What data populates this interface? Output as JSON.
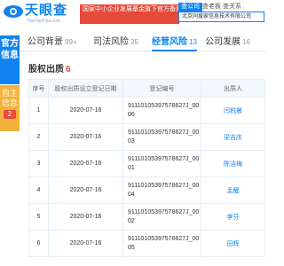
{
  "header": {
    "logo_text": "天眼查",
    "logo_url": "TianYanCha.com",
    "notice": "国家中小企业发展基金旗下官方备案企业征信机构",
    "search_tabs": [
      "查公司",
      "查老板",
      "查关系"
    ],
    "search_value": "北京同援家信息技术有限公司"
  },
  "rail": {
    "official": "官方信息",
    "self": "自主信息",
    "self_count": "2"
  },
  "tabs": [
    {
      "label": "公司背景",
      "count": "99+"
    },
    {
      "label": "司法风险",
      "count": "25"
    },
    {
      "label": "经营风险",
      "count": "13"
    },
    {
      "label": "公司发展",
      "count": "16"
    }
  ],
  "section": {
    "title": "股权出质",
    "count": "6"
  },
  "table": {
    "headers": [
      "序号",
      "股权出质设立登记日期",
      "登记编号",
      "出质人"
    ],
    "rows": [
      {
        "no": "1",
        "date": "2020-07-16",
        "reg": "911101053975786​27J_0006",
        "pledgor": "闫税晨"
      },
      {
        "no": "2",
        "date": "2020-07-16",
        "reg": "911101053975786​27J_0003",
        "pledgor": "梁吉庆"
      },
      {
        "no": "3",
        "date": "2020-07-16",
        "reg": "911101053975786​27J_0001",
        "pledgor": "陈洁梅"
      },
      {
        "no": "4",
        "date": "2020-07-16",
        "reg": "911101053975786​27J_0004",
        "pledgor": "孟醒"
      },
      {
        "no": "5",
        "date": "2020-07-16",
        "reg": "911101053975786​27J_0002",
        "pledgor": "李芬"
      },
      {
        "no": "6",
        "date": "2020-07-16",
        "reg": "911101053975786​27J_0005",
        "pledgor": "田辉"
      }
    ]
  },
  "colors": {
    "brand": "#0f84f1",
    "alert": "#e64a3b",
    "self_info": "#f3b23b"
  }
}
